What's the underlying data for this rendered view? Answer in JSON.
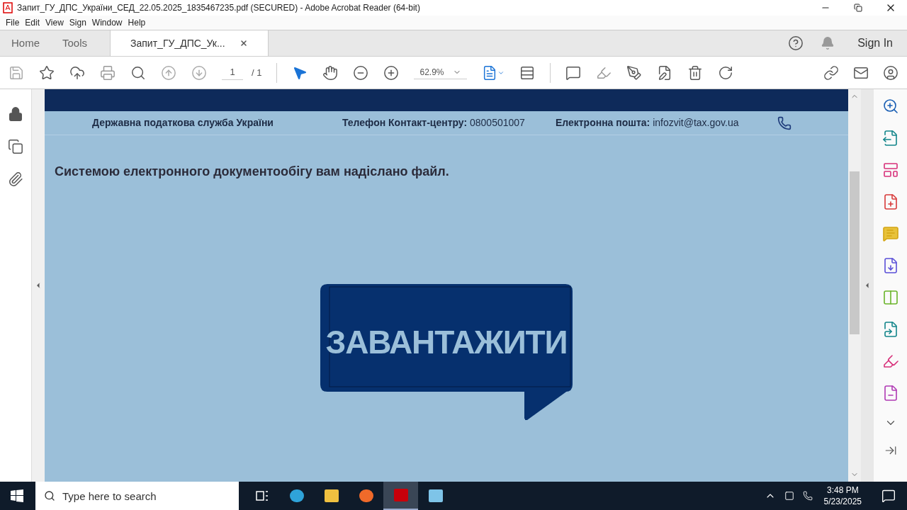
{
  "window": {
    "title": "Запит_ГУ_ДПС_України_СЕД_22.05.2025_1835467235.pdf (SECURED) - Adobe Acrobat Reader (64-bit)"
  },
  "menu": [
    "File",
    "Edit",
    "View",
    "Sign",
    "Window",
    "Help"
  ],
  "tabs": [
    {
      "label": "Home",
      "selected": false,
      "closable": false
    },
    {
      "label": "Tools",
      "selected": false,
      "closable": false
    },
    {
      "label": "Запит_ГУ_ДПС_Ук...",
      "selected": true,
      "closable": true
    }
  ],
  "sign_in": "Sign In",
  "toolbar": {
    "page": "1",
    "page_total": "/ 1",
    "zoom": "62.9%"
  },
  "document": {
    "org": "Державна податкова служба України",
    "phone": "**Телефон Контакт-центру:** 0800501007",
    "email": "**Електронна пошта:** infozvit@tax.gov.ua",
    "message": "Системою електронного документообігу вам надіслано файл.",
    "button": "ЗАВАНТАЖИТИ"
  },
  "taskbar": {
    "search": {
      "placeholder": "Type here to search"
    },
    "time": "3:48 PM",
    "date": "5/23/2025"
  }
}
